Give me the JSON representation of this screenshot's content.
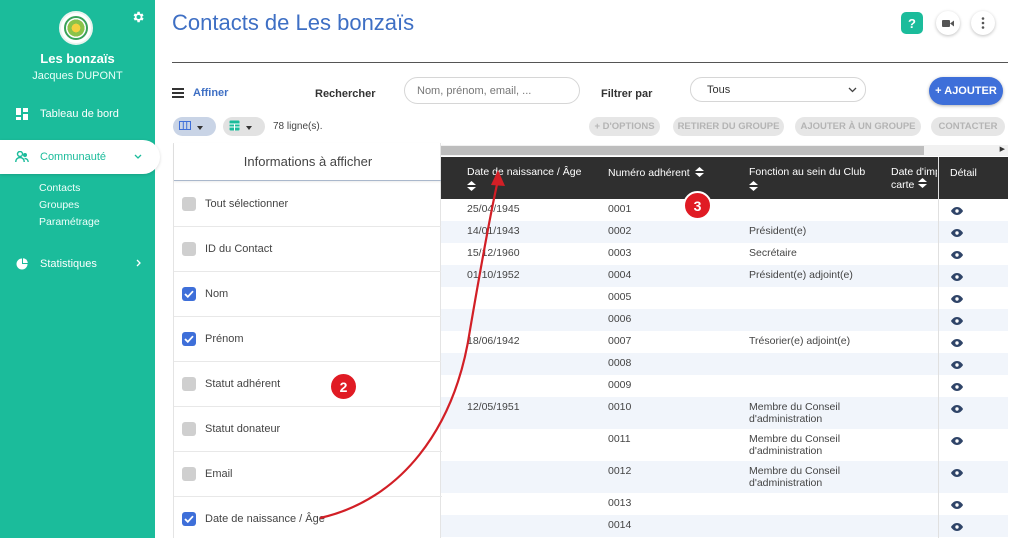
{
  "sidebar": {
    "org_name": "Les bonzaïs",
    "user_name": "Jacques DUPONT",
    "items": [
      {
        "label": "Tableau de bord",
        "icon": "dashboard-icon"
      },
      {
        "label": "Communauté",
        "icon": "community-icon",
        "active": true
      },
      {
        "label": "Statistiques",
        "icon": "chart-pie-icon"
      }
    ],
    "sub_items": [
      "Contacts",
      "Groupes",
      "Paramétrage"
    ]
  },
  "header": {
    "title": "Contacts de Les bonzaïs",
    "help_label": "?"
  },
  "toolbar": {
    "affiner_label": "Affiner",
    "search_label": "Rechercher",
    "search_placeholder": "Nom, prénom, email, ...",
    "filter_label": "Filtrer par",
    "filter_value": "Tous",
    "add_label": "+ AJOUTER",
    "row_count": "78 ligne(s).",
    "actions": [
      "+ D'OPTIONS",
      "RETIRER DU GROUPE",
      "AJOUTER À UN GROUPE",
      "CONTACTER"
    ]
  },
  "info_panel": {
    "title": "Informations à afficher",
    "options": [
      {
        "label": "Tout sélectionner",
        "checked": false
      },
      {
        "label": "ID du Contact",
        "checked": false
      },
      {
        "label": "Nom",
        "checked": true
      },
      {
        "label": "Prénom",
        "checked": true
      },
      {
        "label": "Statut adhérent",
        "checked": false
      },
      {
        "label": "Statut donateur",
        "checked": false
      },
      {
        "label": "Email",
        "checked": false
      },
      {
        "label": "Date de naissance / Âge",
        "checked": true
      }
    ]
  },
  "table": {
    "columns": [
      "Date de naissance / Âge",
      "Numéro adhérent",
      "Fonction au sein du Club",
      "Date d'impr",
      "carte",
      "Détail"
    ],
    "rows": [
      {
        "birth": "25/04/1945",
        "num": "0001",
        "role": ""
      },
      {
        "birth": "14/01/1943",
        "num": "0002",
        "role": "Président(e)"
      },
      {
        "birth": "15/12/1960",
        "num": "0003",
        "role": "Secrétaire"
      },
      {
        "birth": "01/10/1952",
        "num": "0004",
        "role": "Président(e) adjoint(e)"
      },
      {
        "birth": "",
        "num": "0005",
        "role": ""
      },
      {
        "birth": "",
        "num": "0006",
        "role": ""
      },
      {
        "birth": "18/06/1942",
        "num": "0007",
        "role": "Trésorier(e) adjoint(e)"
      },
      {
        "birth": "",
        "num": "0008",
        "role": ""
      },
      {
        "birth": "",
        "num": "0009",
        "role": ""
      },
      {
        "birth": "12/05/1951",
        "num": "0010",
        "role": "Membre du Conseil d'administration"
      },
      {
        "birth": "",
        "num": "0011",
        "role": "Membre du Conseil d'administration"
      },
      {
        "birth": "",
        "num": "0012",
        "role": "Membre du Conseil d'administration"
      },
      {
        "birth": "",
        "num": "0013",
        "role": ""
      },
      {
        "birth": "",
        "num": "0014",
        "role": ""
      }
    ]
  },
  "annotations": {
    "badge_2": "2",
    "badge_3": "3",
    "color": "#e01b24"
  },
  "colors": {
    "sidebar": "#1bbc9b",
    "accent": "#3e6fd9",
    "header_bg": "#2f2f2f"
  }
}
